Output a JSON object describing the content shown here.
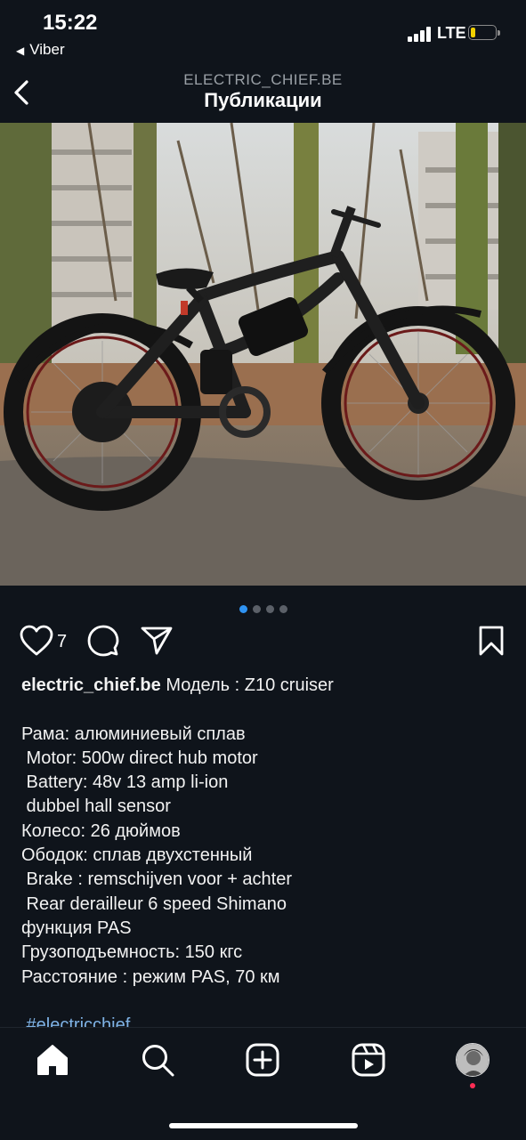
{
  "status": {
    "time": "15:22",
    "back_app": "Viber",
    "network": "LTE",
    "battery_level": 0.2,
    "battery_color": "#f0d000"
  },
  "header": {
    "account": "ELECTRIC_CHIEF.BE",
    "title": "Публикации",
    "back_icon": "chevron-left-icon"
  },
  "post": {
    "image_alt": "black fat-tire electric bike standing in a park",
    "carousel": {
      "count": 4,
      "active": 1,
      "active_color": "#2f93f2"
    },
    "likes": "7",
    "username": "electric_chief.be",
    "caption_first": "Модель : Z10 cruiser",
    "caption_lines": [
      "Рама: алюминиевый сплав",
      " Motor: 500w direct hub motor",
      " Battery: 48v 13 amp li-ion",
      " dubbel hall sensor",
      "Колесо: 26 дюймов",
      "Ободок: сплав двухстенный",
      " Brake : remschijven voor + achter",
      " Rear derailleur 6 speed Shimano",
      "функция PAS",
      "Грузоподъемность: 150 кгс",
      "Расстояние : режим PAS, 70 км"
    ],
    "hashtag": " #electricchief"
  },
  "tabbar": {
    "items": [
      "home-icon",
      "search-icon",
      "create-icon",
      "reels-icon",
      "profile-avatar"
    ]
  }
}
